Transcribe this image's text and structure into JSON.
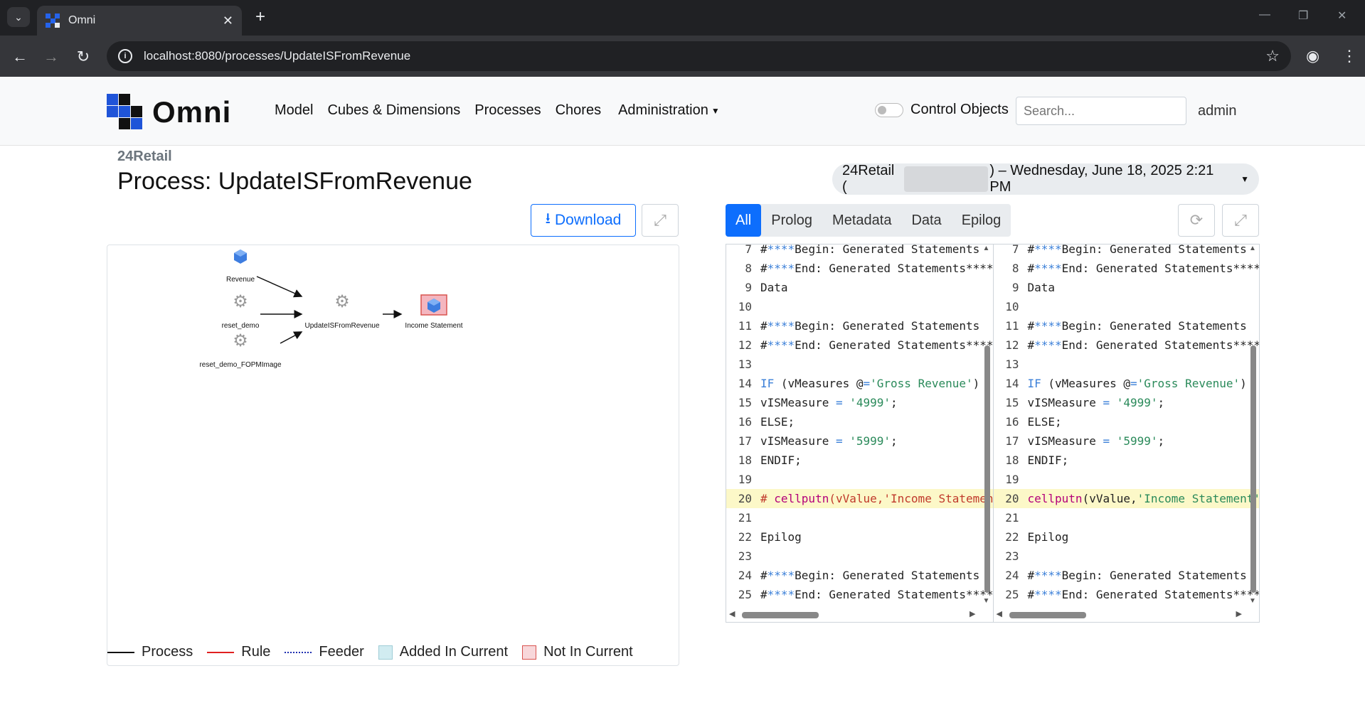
{
  "browser": {
    "tab_title": "Omni",
    "url": "localhost:8080/processes/UpdateISFromRevenue"
  },
  "nav": {
    "brand": "Omni",
    "links": [
      "Model",
      "Cubes & Dimensions",
      "Processes",
      "Chores",
      "Administration"
    ],
    "control_objects_label": "Control Objects",
    "search_placeholder": "Search...",
    "user": "admin"
  },
  "page": {
    "model": "24Retail",
    "title": "Process: UpdateISFromRevenue",
    "server_prefix": "24Retail (",
    "server_suffix": ") – Wednesday, June 18, 2025 2:21 PM"
  },
  "diagram": {
    "download_label": "Download",
    "nodes": [
      "Revenue",
      "reset_demo",
      "reset_demo_FOPMImage",
      "UpdateISFromRevenue",
      "Income Statement"
    ],
    "legend": [
      "Process",
      "Rule",
      "Feeder",
      "Added In Current",
      "Not In Current"
    ]
  },
  "code": {
    "tabs": [
      "All",
      "Prolog",
      "Metadata",
      "Data",
      "Epilog"
    ],
    "active_tab": "All",
    "left_lines": [
      {
        "n": "7",
        "t": "#****Begin: Generated Statements"
      },
      {
        "n": "8",
        "t": "#****End: Generated Statements****"
      },
      {
        "n": "9",
        "t": "Data"
      },
      {
        "n": "10",
        "t": ""
      },
      {
        "n": "11",
        "t": "#****Begin: Generated Statements"
      },
      {
        "n": "12",
        "t": "#****End: Generated Statements****"
      },
      {
        "n": "13",
        "t": ""
      },
      {
        "n": "14",
        "t": "IF (vMeasures @='Gross Revenue')"
      },
      {
        "n": "15",
        "t": "vISMeasure = '4999';"
      },
      {
        "n": "16",
        "t": "ELSE;"
      },
      {
        "n": "17",
        "t": "vISMeasure = '5999';"
      },
      {
        "n": "18",
        "t": "ENDIF;"
      },
      {
        "n": "19",
        "t": ""
      },
      {
        "n": "20",
        "t": "# cellputn(vValue,'Income Statement'"
      },
      {
        "n": "21",
        "t": ""
      },
      {
        "n": "22",
        "t": "Epilog"
      },
      {
        "n": "23",
        "t": ""
      },
      {
        "n": "24",
        "t": "#****Begin: Generated Statements"
      },
      {
        "n": "25",
        "t": "#****End: Generated Statements****"
      }
    ],
    "right_lines": [
      {
        "n": "7",
        "t": "#****Begin: Generated Statements"
      },
      {
        "n": "8",
        "t": "#****End: Generated Statements****"
      },
      {
        "n": "9",
        "t": "Data"
      },
      {
        "n": "10",
        "t": ""
      },
      {
        "n": "11",
        "t": "#****Begin: Generated Statements"
      },
      {
        "n": "12",
        "t": "#****End: Generated Statements****"
      },
      {
        "n": "13",
        "t": ""
      },
      {
        "n": "14",
        "t": "IF (vMeasures @='Gross Revenue')"
      },
      {
        "n": "15",
        "t": "vISMeasure = '4999';"
      },
      {
        "n": "16",
        "t": "ELSE;"
      },
      {
        "n": "17",
        "t": "vISMeasure = '5999';"
      },
      {
        "n": "18",
        "t": "ENDIF;"
      },
      {
        "n": "19",
        "t": ""
      },
      {
        "n": "20",
        "t": "cellputn(vValue,'Income Statement'"
      },
      {
        "n": "21",
        "t": ""
      },
      {
        "n": "22",
        "t": "Epilog"
      },
      {
        "n": "23",
        "t": ""
      },
      {
        "n": "24",
        "t": "#****Begin: Generated Statements"
      },
      {
        "n": "25",
        "t": "#****End: Generated Statements****"
      }
    ],
    "highlight_line": "20"
  },
  "colors": {
    "primary": "#0d6efd",
    "highlight": "#fcf8c8",
    "not_in_current": "#f8d7da",
    "added_in_current": "#d1ecf1"
  }
}
